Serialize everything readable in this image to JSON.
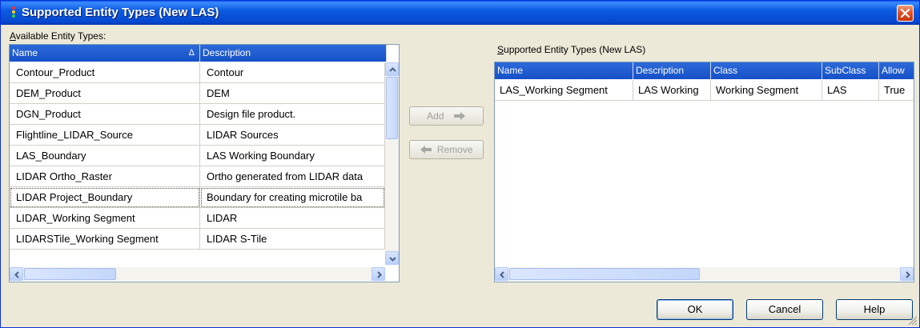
{
  "window": {
    "title": "Supported Entity Types  (New LAS)",
    "icon": "traffic-light-icon",
    "close": "close-icon"
  },
  "available": {
    "label_key": "A",
    "label_rest": "vailable Entity Types:",
    "columns": [
      "Name",
      "Description"
    ],
    "sort_indicator": "Δ",
    "rows": [
      {
        "name": "Contour_Product",
        "description": "Contour"
      },
      {
        "name": "DEM_Product",
        "description": "DEM"
      },
      {
        "name": "DGN_Product",
        "description": "Design file product."
      },
      {
        "name": "Flightline_LIDAR_Source",
        "description": "LIDAR Sources"
      },
      {
        "name": "LAS_Boundary",
        "description": "LAS Working Boundary"
      },
      {
        "name": "LIDAR Ortho_Raster",
        "description": "Ortho generated from LIDAR data"
      },
      {
        "name": "LIDAR Project_Boundary",
        "description": "Boundary for creating microtile ba"
      },
      {
        "name": "LIDAR_Working Segment",
        "description": "LIDAR"
      },
      {
        "name": "LIDARSTile_Working Segment",
        "description": "LIDAR S-Tile"
      }
    ]
  },
  "actions": {
    "add_label": "Add",
    "remove_label": "Remove"
  },
  "supported": {
    "label_key": "S",
    "label_rest": "upported Entity Types  (New LAS)",
    "columns": [
      "Name",
      "Description",
      "Class",
      "SubClass",
      "Allow"
    ],
    "rows": [
      {
        "name": "LAS_Working Segment",
        "description": "LAS Working",
        "class": "Working Segment",
        "subclass": "LAS",
        "allow": "True"
      }
    ]
  },
  "buttons": {
    "ok": "OK",
    "cancel": "Cancel",
    "help": "Help"
  },
  "colors": {
    "title_bar": "#0b5be0",
    "header": "#1650c8",
    "dialog_bg": "#ece9d8"
  }
}
